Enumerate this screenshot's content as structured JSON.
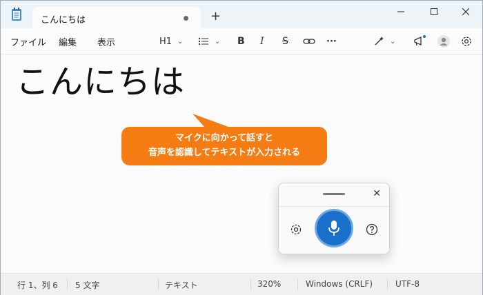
{
  "window": {
    "tab_title": "こんにちは",
    "new_tab_label": "+"
  },
  "menu": {
    "file": "ファイル",
    "edit": "編集",
    "view": "表示"
  },
  "toolbar": {
    "heading": "H1",
    "bold": "B",
    "italic": "I",
    "strike": "S",
    "more": "···"
  },
  "document": {
    "text": "こんにちは"
  },
  "callout": {
    "line1": "マイクに向かって話すと",
    "line2": "音声を認識してテキストが入力される",
    "color": "#f47c12"
  },
  "voice_panel": {
    "close_label": "✕",
    "mic_color": "#1a6fc9"
  },
  "status": {
    "position": "行 1、列 6",
    "char_count": "5 文字",
    "format": "テキスト",
    "zoom": "320%",
    "line_ending": "Windows (CRLF)",
    "encoding": "UTF-8"
  }
}
